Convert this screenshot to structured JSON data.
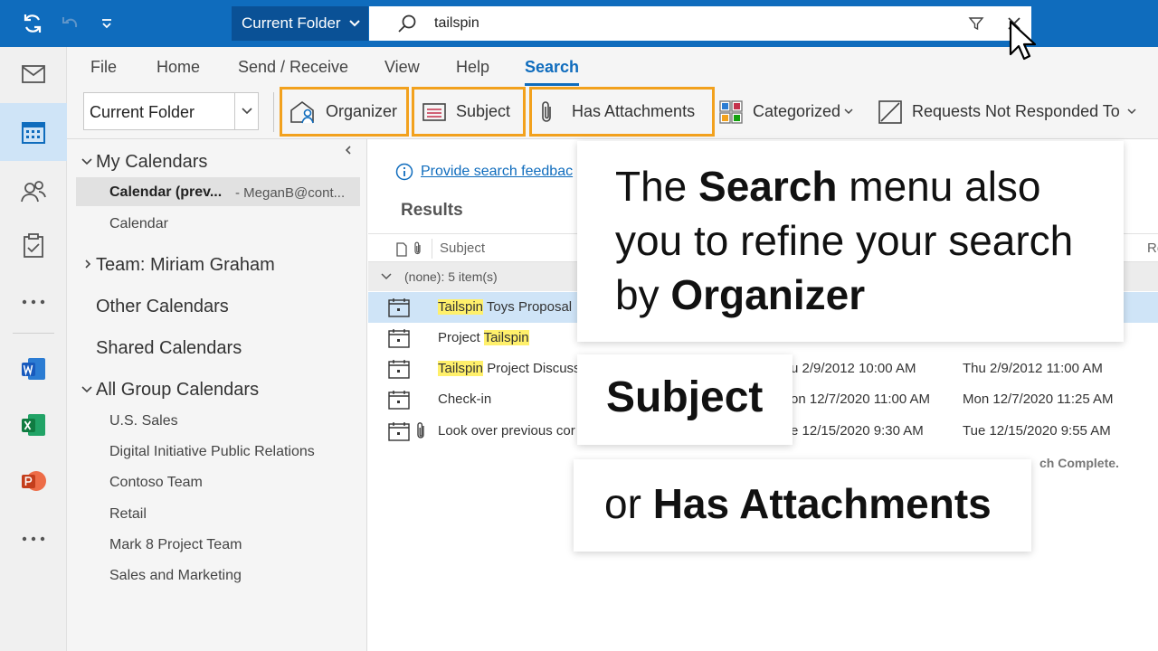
{
  "titlebar": {
    "scope_label": "Current Folder",
    "search_query": "tailspin"
  },
  "menu": {
    "tabs": [
      "File",
      "Home",
      "Send / Receive",
      "View",
      "Help",
      "Search"
    ],
    "active": "Search"
  },
  "ribbon": {
    "scope_select": "Current Folder",
    "organizer": "Organizer",
    "subject": "Subject",
    "has_attachments": "Has Attachments",
    "categorized": "Categorized",
    "requests": "Requests Not Responded To"
  },
  "folders": {
    "my_calendars": "My Calendars",
    "calendar_preview": "Calendar (prev...",
    "calendar_preview_account": "- MeganB@cont...",
    "calendar": "Calendar",
    "team": "Team: Miriam Graham",
    "other": "Other Calendars",
    "shared": "Shared Calendars",
    "all_group": "All Group Calendars",
    "groups": [
      "U.S. Sales",
      "Digital Initiative Public Relations",
      "Contoso Team",
      "Retail",
      "Mark 8 Project Team",
      "Sales and Marketing"
    ]
  },
  "results": {
    "feedback_link": "Provide search feedbac",
    "title": "Results",
    "col_subject": "Subject",
    "col_right_partial": "Re",
    "group_label": "(none): 5 item(s)",
    "rows": [
      {
        "pre": "",
        "hl": "Tailspin",
        "post": " Toys Proposal",
        "start": "",
        "end": ""
      },
      {
        "pre": "Project ",
        "hl": "Tailspin",
        "post": "",
        "start": "",
        "end": ""
      },
      {
        "pre": "",
        "hl": "Tailspin",
        "post": " Project Discuss",
        "start": "u 2/9/2012 10:00 AM",
        "end": "Thu 2/9/2012 11:00 AM"
      },
      {
        "pre": "Check-in",
        "hl": "",
        "post": "",
        "start": "on 12/7/2020 11:00 AM",
        "end": "Mon 12/7/2020 11:25 AM"
      },
      {
        "pre": "Look over previous cor",
        "hl": "",
        "post": "",
        "start": "e 12/15/2020 9:30 AM",
        "end": "Tue 12/15/2020 9:55 AM"
      }
    ],
    "status": "ch Complete."
  },
  "callouts": {
    "main_1": "The ",
    "main_bold_1": "Search",
    "main_2": " menu also",
    "main_3": "you to refine your search",
    "main_4": "by ",
    "main_bold_2": "Organizer",
    "subject": "Subject",
    "or": "or ",
    "has_attachments": "Has Attachments"
  },
  "colors": {
    "brand": "#0f6cbd",
    "highlight_outline": "#f2a11d",
    "search_highlight": "#fff06b"
  }
}
